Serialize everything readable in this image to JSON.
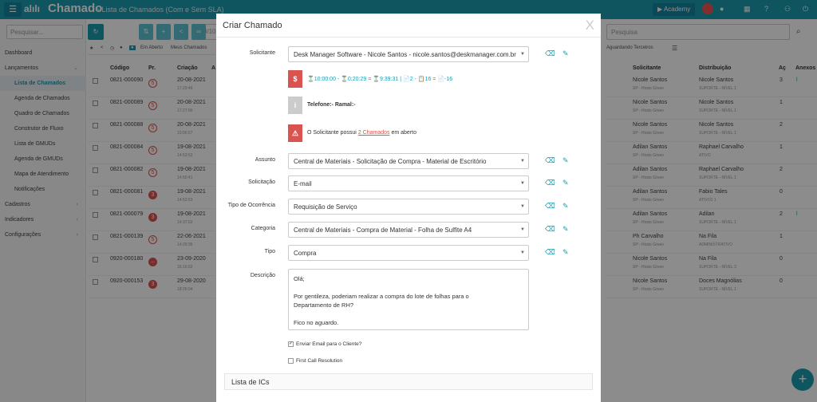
{
  "header": {
    "title": "Chamado",
    "breadcrumb": "» Lista de Chamados (Com e Sem SLA)",
    "academy": "Academy"
  },
  "left": {
    "search_placeholder": "Pesquisar...",
    "nav": [
      {
        "label": "Dashboard",
        "sub": false
      },
      {
        "label": "Lançamentos",
        "sub": false,
        "arrow": "⌄"
      },
      {
        "label": "Lista de Chamados",
        "sub": true,
        "active": true
      },
      {
        "label": "Agenda de Chamados",
        "sub": true
      },
      {
        "label": "Quadro de Chamados",
        "sub": true
      },
      {
        "label": "Construtor de Fluxo",
        "sub": true
      },
      {
        "label": "Lista de GMUDs",
        "sub": true
      },
      {
        "label": "Agenda de GMUDs",
        "sub": true
      },
      {
        "label": "Mapa de Atendimento",
        "sub": true
      },
      {
        "label": "Notificações",
        "sub": true
      },
      {
        "label": "Cadastros",
        "sub": false,
        "arrow": "‹"
      },
      {
        "label": "Indicadores",
        "sub": false,
        "arrow": "‹"
      },
      {
        "label": "Configurações",
        "sub": false,
        "arrow": "‹"
      }
    ]
  },
  "toolbar": {
    "pager": "10/10",
    "filters": [
      "Em Aberto",
      "Meus Chamados"
    ],
    "right_tab": "Aguardando Terceiros"
  },
  "right_search_placeholder": "Pesquisa",
  "table": {
    "head_left": [
      "Código",
      "Pr.",
      "Criação",
      "A"
    ],
    "head_right": [
      "Solicitante",
      "Distribuição",
      "Aç",
      "Anexos"
    ],
    "rows": [
      {
        "code": "0821-000090",
        "pr": "5",
        "date": "20-08-2021",
        "time": "17:29:46",
        "sol": "Nicole Santos",
        "sol2": "SP - Hosts Green",
        "dist": "Nicole Santos",
        "dist2": "SUPORTE - NÍVEL 1",
        "ac": "3",
        "clip": true
      },
      {
        "code": "0821-000089",
        "pr": "5",
        "date": "20-08-2021",
        "time": "17:27:00",
        "sol": "Nicole Santos",
        "sol2": "SP - Hosts Green",
        "dist": "Nicole Santos",
        "dist2": "SUPORTE - NÍVEL 1",
        "ac": "1",
        "clip": false
      },
      {
        "code": "0821-000088",
        "pr": "5",
        "date": "20-08-2021",
        "time": "10:06:07",
        "sol": "Nicole Santos",
        "sol2": "SP - Hosts Green",
        "dist": "Nicole Santos",
        "dist2": "SUPORTE - NÍVEL 1",
        "ac": "2",
        "clip": false
      },
      {
        "code": "0821-000084",
        "pr": "5",
        "date": "19-08-2021",
        "time": "14:53:52",
        "sol": "Adilan Santos",
        "sol2": "SP - Hosts Green",
        "dist": "Raphael Carvalho",
        "dist2": "ATIVO",
        "ac": "1",
        "clip": false
      },
      {
        "code": "0821-000082",
        "pr": "5",
        "date": "19-08-2021",
        "time": "14:50:41",
        "sol": "Adilan Santos",
        "sol2": "SP - Hosts Green",
        "dist": "Raphael Carvalho",
        "dist2": "SUPORTE - NÍVEL 1",
        "ac": "2",
        "clip": false
      },
      {
        "code": "0821-000081",
        "pr": "3",
        "date": "19-08-2021",
        "time": "14:52:03",
        "sol": "Adilan Santos",
        "sol2": "SP - Hosts Green",
        "dist": "Fabio Tales",
        "dist2": "ATIVO2 1",
        "ac": "0",
        "clip": false
      },
      {
        "code": "0821-000079",
        "pr": "3",
        "date": "19-08-2021",
        "time": "14:37:02",
        "sol": "Adilan Santos",
        "sol2": "SP - Hosts Green",
        "dist": "Adilan",
        "dist2": "SUPORTE - NÍVEL 1",
        "ac": "2",
        "clip": true
      },
      {
        "code": "0821-000139",
        "pr": "5",
        "date": "22-06-2021",
        "time": "14:29:36",
        "sol": "Ph Carvalho",
        "sol2": "SP - Hosts Green",
        "dist": "Na Fila",
        "dist2": "ADMINISTRATIVO",
        "ac": "1",
        "clip": false
      },
      {
        "code": "0920-000180",
        "pr": "–",
        "date": "23-09-2020",
        "time": "16:16:02",
        "sol": "Nicole Santos",
        "sol2": "SP - Hosts Green",
        "dist": "Na Fila",
        "dist2": "SUPORTE - NÍVEL 3",
        "ac": "0",
        "clip": false
      },
      {
        "code": "0920-000153",
        "pr": "3",
        "date": "29-08-2020",
        "time": "18:26:04",
        "sol": "Nicole Santos",
        "sol2": "SP - Hosts Green",
        "dist": "Doces Magnólias",
        "dist2": "SUPORTE - NÍVEL 1",
        "ac": "0",
        "clip": false
      }
    ]
  },
  "modal": {
    "title": "Criar Chamado",
    "close": "X",
    "solicitante_label": "Solicitante",
    "solicitante_value": "Desk Manager Software - Nicole Santos - nicole.santos@deskmanager.com.br",
    "sla_text": "⏳10:00:00 - ⏳0:20:29 = ⏳9:39:31 | 📄2 - 📋16 = 📄-16",
    "phone_text": "Telefone:- Ramal:-",
    "warning_prefix": "O Solicitante possui ",
    "warning_link": "2 Chamados",
    "warning_suffix": " em aberto",
    "fields": [
      {
        "label": "Assunto",
        "value": "Central de Materiais - Solicitação de Compra - Material de Escritório"
      },
      {
        "label": "Solicitação",
        "value": "E-mail"
      },
      {
        "label": "Tipo de Ocorrência",
        "value": "Requisição de Serviço"
      },
      {
        "label": "Categoria",
        "value": "Central de Materiais - Compra de Material - Folha de Sulfite A4"
      },
      {
        "label": "Tipo",
        "value": "Compra"
      }
    ],
    "descricao_label": "Descrição",
    "descricao_lines": [
      "Olá;",
      "",
      "Por gentileza, poderiam realizar a compra do lote de folhas para o",
      "Departamento de RH?",
      "",
      "Fico no aguardo."
    ],
    "check1": "Enviar Email para o Cliente?",
    "check2": "First Call Resolution",
    "section": "Lista de ICs"
  },
  "colors": {
    "accent": "#1d9bb0",
    "danger": "#d9534f",
    "info": "#ccc"
  }
}
